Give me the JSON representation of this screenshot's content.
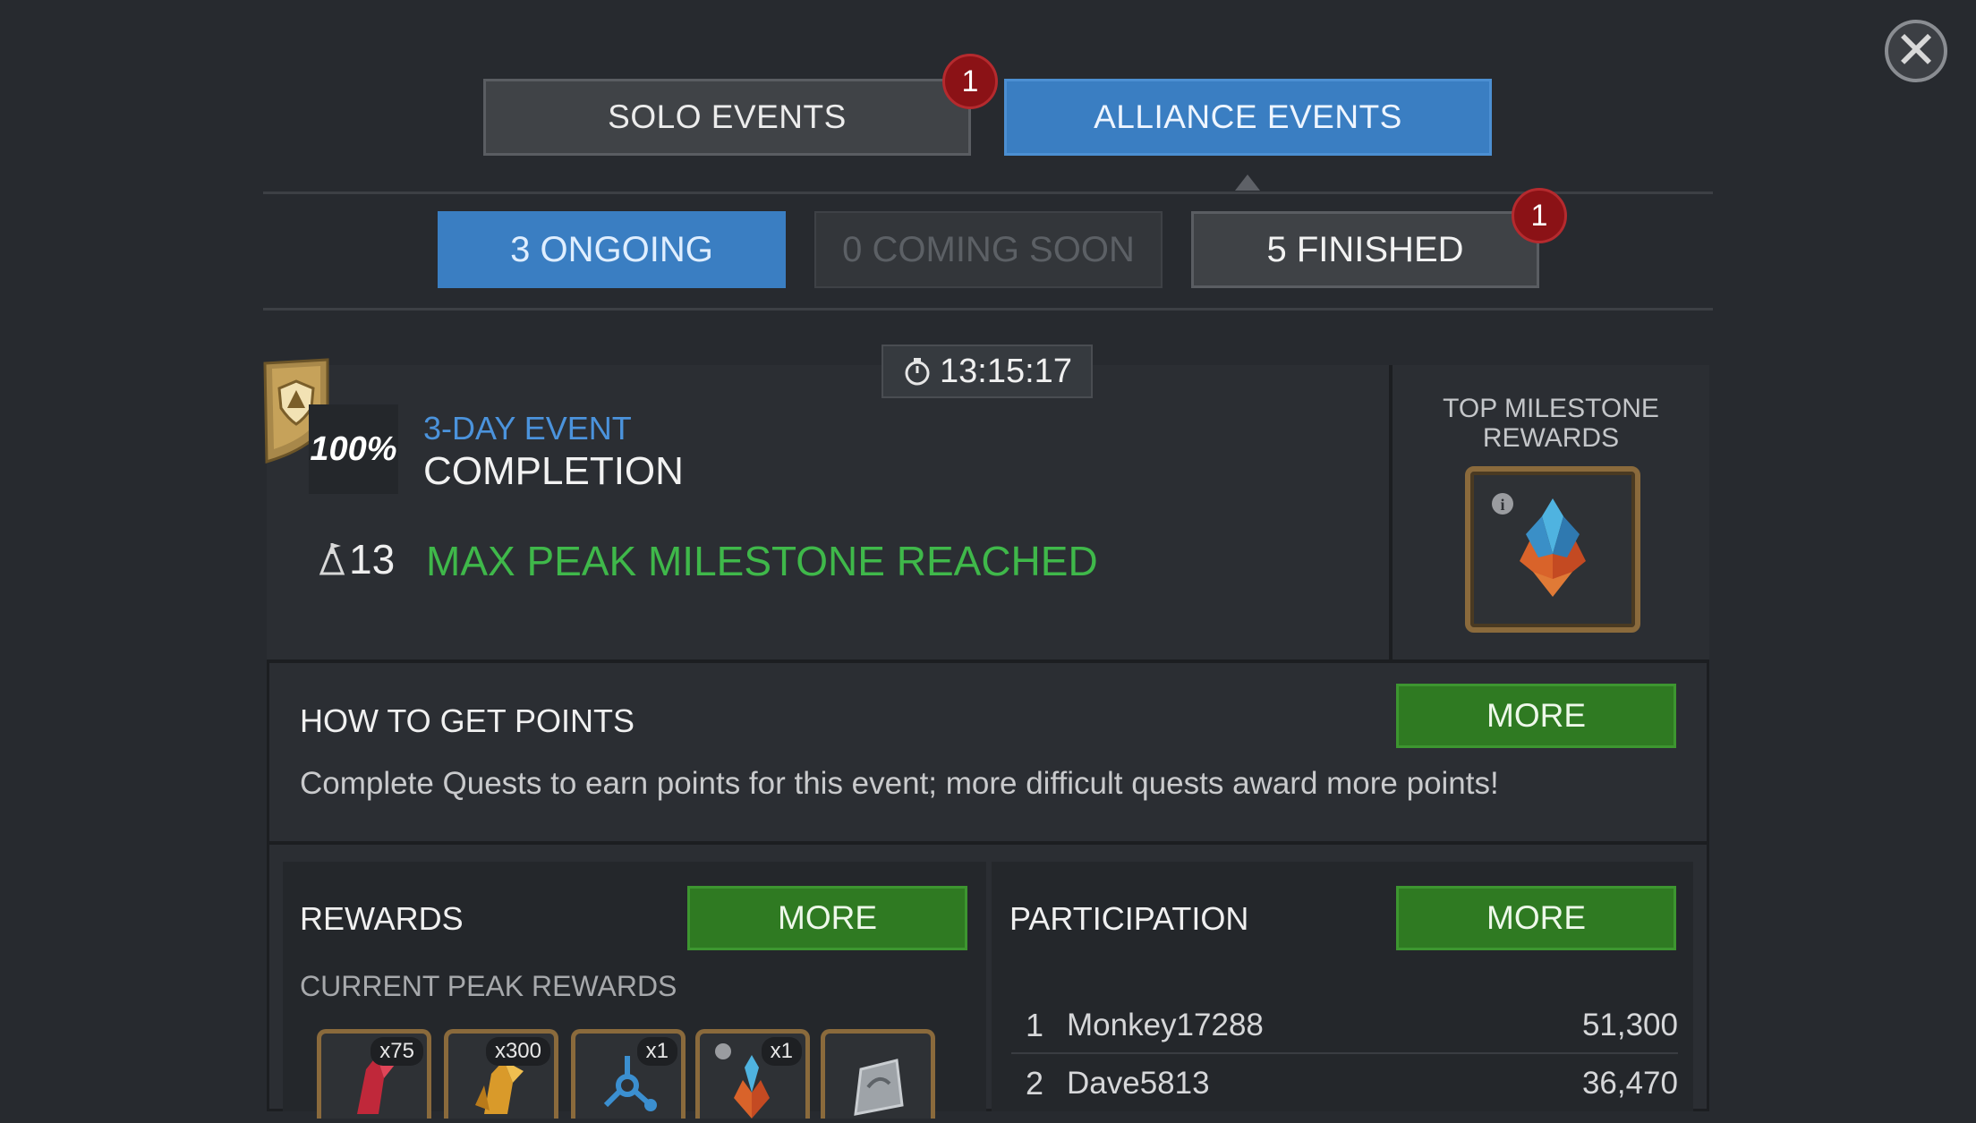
{
  "tabs": {
    "solo": {
      "label": "SOLO EVENTS",
      "badge": "1"
    },
    "alliance": {
      "label": "ALLIANCE EVENTS"
    }
  },
  "filters": {
    "ongoing": "3 ONGOING",
    "coming_soon": "0 COMING SOON",
    "finished": "5 FINISHED",
    "finished_badge": "1"
  },
  "event": {
    "timer": "13:15:17",
    "completion_pct": "100%",
    "type": "3-DAY EVENT",
    "name": "COMPLETION",
    "peak_level": "13",
    "peak_message": "MAX PEAK MILESTONE REACHED",
    "top_milestone_title": "TOP MILESTONE REWARDS"
  },
  "how_to": {
    "title": "HOW TO GET POINTS",
    "more": "MORE",
    "description": "Complete Quests to earn points for this event; more difficult quests award more points!"
  },
  "rewards": {
    "title": "REWARDS",
    "more": "MORE",
    "subtitle": "CURRENT PEAK REWARDS",
    "items": [
      {
        "qty": "x75",
        "icon": "red-shard-icon"
      },
      {
        "qty": "x300",
        "icon": "gold-shard-icon"
      },
      {
        "qty": "x1",
        "icon": "catalyst-icon"
      },
      {
        "qty": "x1",
        "icon": "crystal-icon"
      },
      {
        "qty": "",
        "icon": "sig-stone-icon"
      }
    ]
  },
  "participation": {
    "title": "PARTICIPATION",
    "more": "MORE",
    "rows": [
      {
        "rank": "1",
        "name": "Monkey17288",
        "score": "51,300"
      },
      {
        "rank": "2",
        "name": "Dave5813",
        "score": "36,470"
      }
    ]
  },
  "colors": {
    "accent_blue": "#3a7ec2",
    "green_button": "#2f7a22",
    "milestone_green": "#3fb84a",
    "badge_red": "#8b1216"
  }
}
